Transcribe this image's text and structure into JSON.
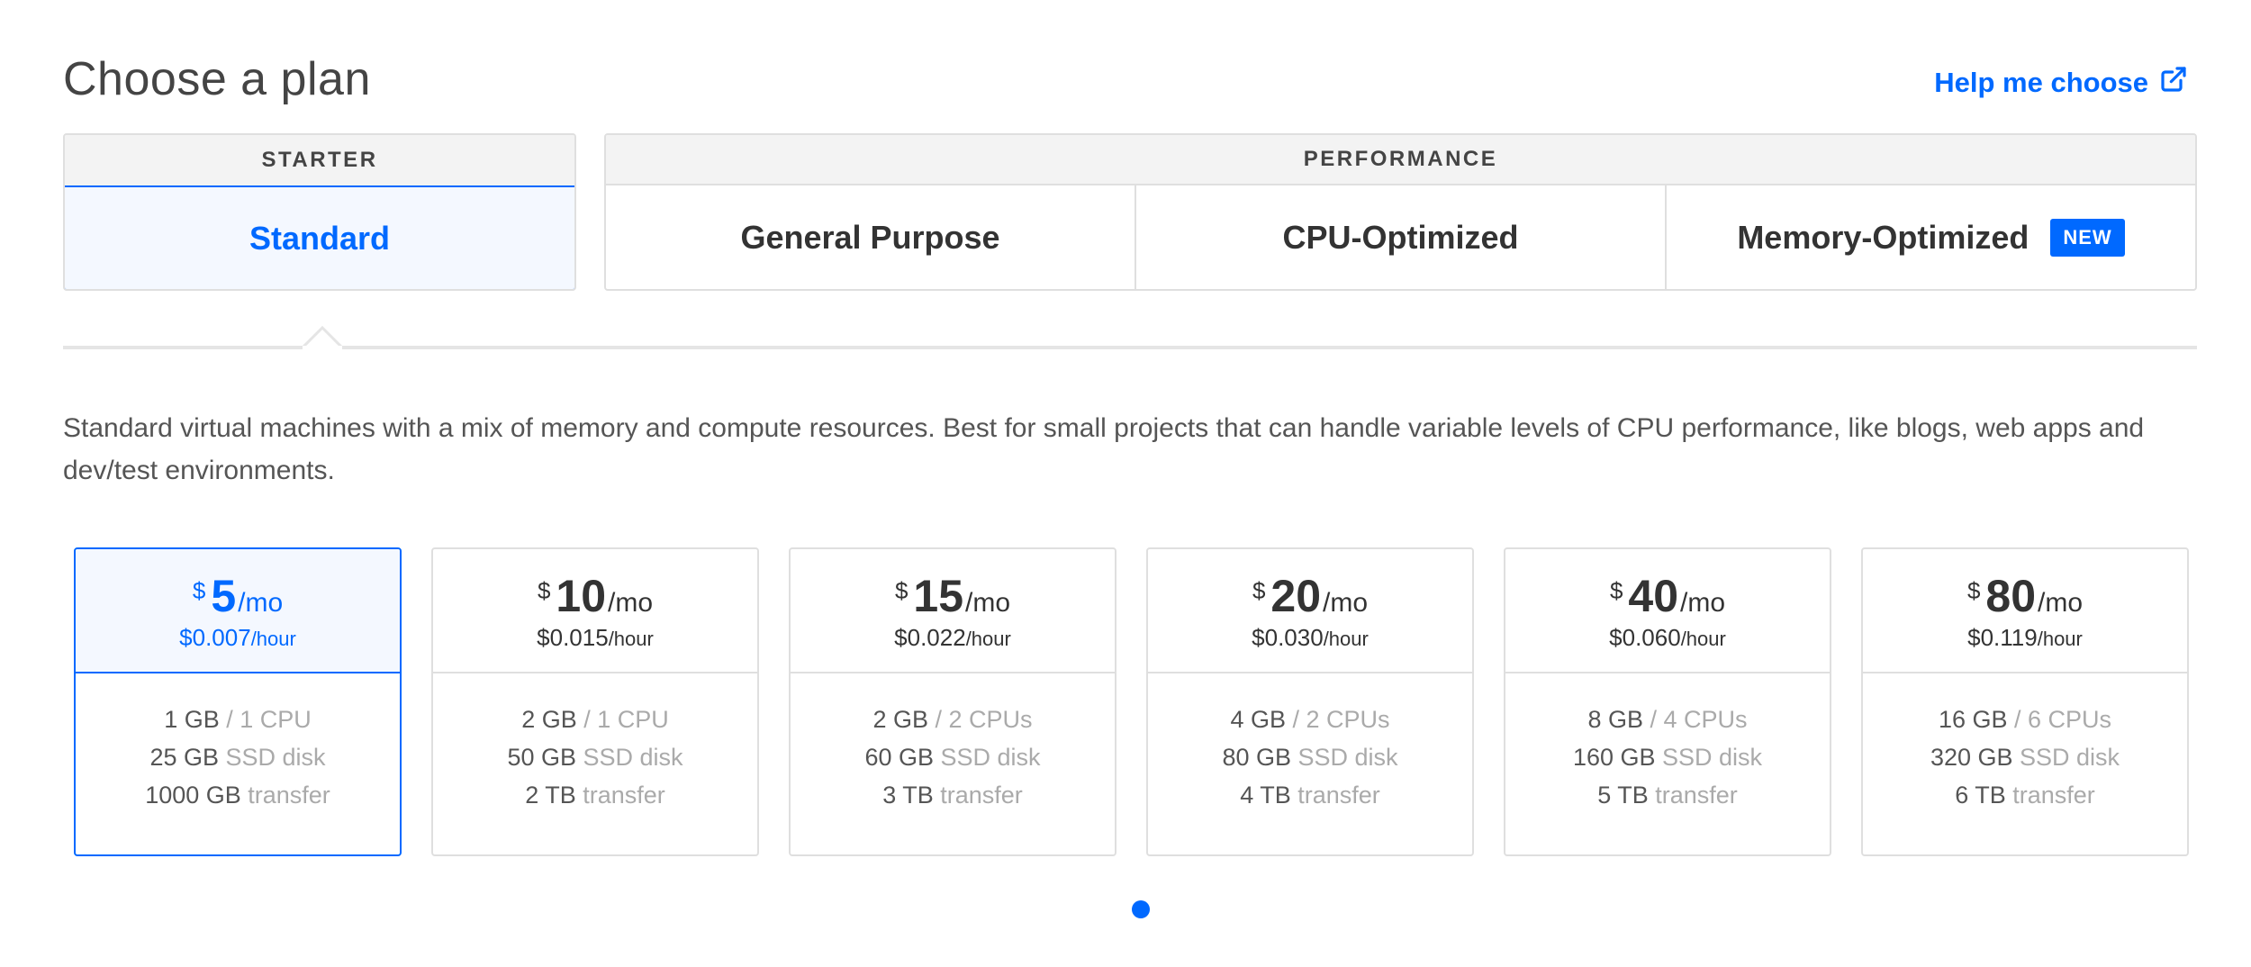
{
  "header": {
    "title": "Choose a plan",
    "help_label": "Help me choose"
  },
  "groups": {
    "starter": {
      "label": "STARTER",
      "tabs": [
        "Standard"
      ]
    },
    "performance": {
      "label": "PERFORMANCE",
      "tabs": [
        "General Purpose",
        "CPU-Optimized",
        "Memory-Optimized"
      ],
      "badge": "NEW"
    }
  },
  "description": "Standard virtual machines with a mix of memory and compute resources. Best for small projects that can handle variable levels of CPU performance, like blogs, web apps and dev/test environments.",
  "plans": [
    {
      "dollar": "$",
      "amount": "5",
      "per": "/mo",
      "hourly": "$0.007",
      "hour_unit": "/hour",
      "memory": "1 GB",
      "cpu": " / 1 CPU",
      "disk": "25 GB",
      "disk_unit": " SSD disk",
      "transfer": "1000 GB",
      "transfer_unit": " transfer"
    },
    {
      "dollar": "$",
      "amount": "10",
      "per": "/mo",
      "hourly": "$0.015",
      "hour_unit": "/hour",
      "memory": "2 GB",
      "cpu": " / 1 CPU",
      "disk": "50 GB",
      "disk_unit": " SSD disk",
      "transfer": "2 TB",
      "transfer_unit": " transfer"
    },
    {
      "dollar": "$",
      "amount": "15",
      "per": "/mo",
      "hourly": "$0.022",
      "hour_unit": "/hour",
      "memory": "2 GB",
      "cpu": " / 2 CPUs",
      "disk": "60 GB",
      "disk_unit": " SSD disk",
      "transfer": "3 TB",
      "transfer_unit": " transfer"
    },
    {
      "dollar": "$",
      "amount": "20",
      "per": "/mo",
      "hourly": "$0.030",
      "hour_unit": "/hour",
      "memory": "4 GB",
      "cpu": " / 2 CPUs",
      "disk": "80 GB",
      "disk_unit": " SSD disk",
      "transfer": "4 TB",
      "transfer_unit": " transfer"
    },
    {
      "dollar": "$",
      "amount": "40",
      "per": "/mo",
      "hourly": "$0.060",
      "hour_unit": "/hour",
      "memory": "8 GB",
      "cpu": " / 4 CPUs",
      "disk": "160 GB",
      "disk_unit": " SSD disk",
      "transfer": "5 TB",
      "transfer_unit": " transfer"
    },
    {
      "dollar": "$",
      "amount": "80",
      "per": "/mo",
      "hourly": "$0.119",
      "hour_unit": "/hour",
      "memory": "16 GB",
      "cpu": " / 6 CPUs",
      "disk": "320 GB",
      "disk_unit": " SSD disk",
      "transfer": "6 TB",
      "transfer_unit": " transfer"
    }
  ],
  "colors": {
    "accent": "#0069ff",
    "selected_bg": "#f4f8ff",
    "border": "#dfdfdf"
  },
  "icons": {
    "help": "external-link-icon"
  }
}
